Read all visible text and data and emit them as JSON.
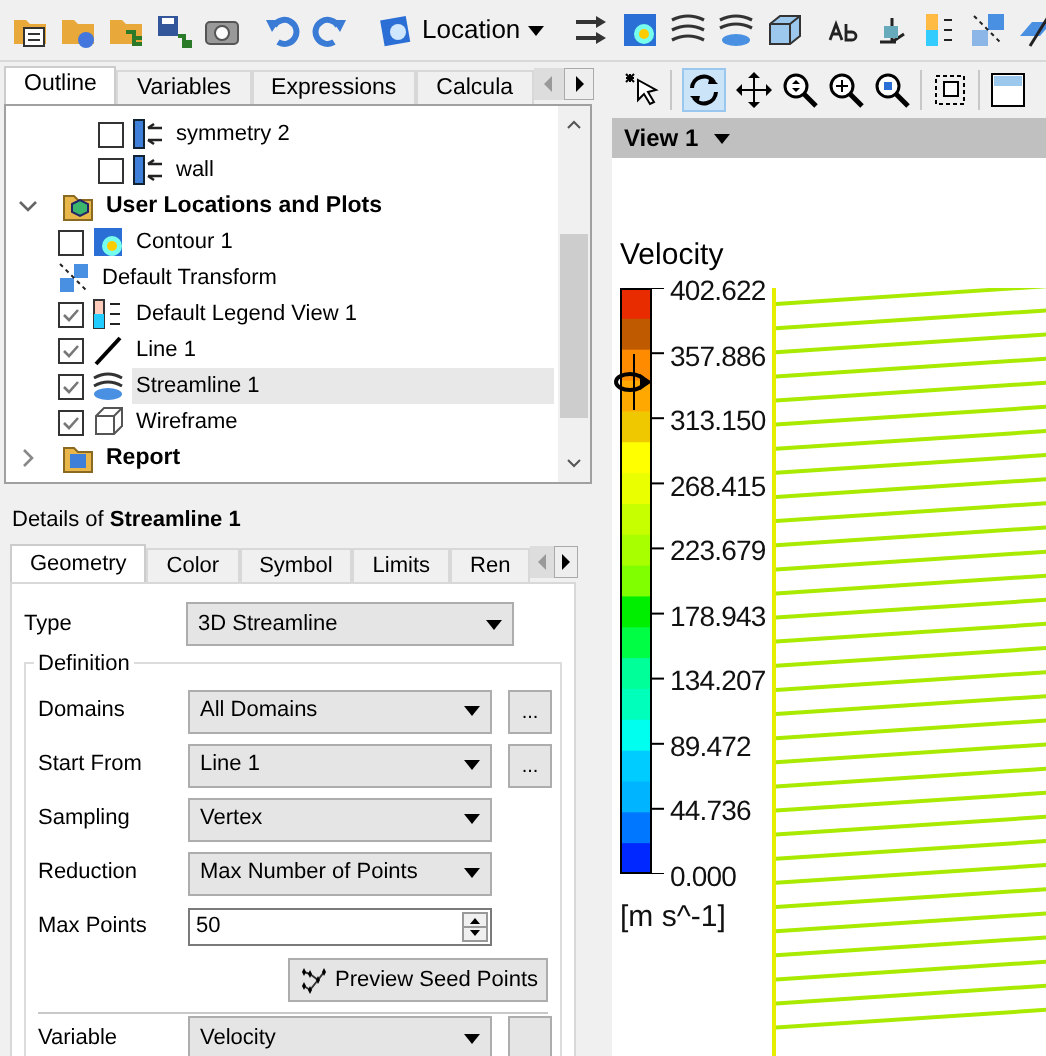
{
  "toolbar": {
    "location_button": "Location"
  },
  "panel_tabs": [
    {
      "label": "Outline",
      "selected": true
    },
    {
      "label": "Variables",
      "selected": false
    },
    {
      "label": "Expressions",
      "selected": false
    },
    {
      "label": "Calcula",
      "selected": false
    }
  ],
  "tree": [
    {
      "children": [
        {
          "children": [
            {
              "label": "symmetry 2",
              "kind": "boundary",
              "checked": false,
              "selected": false
            },
            {
              "label": "wall",
              "kind": "boundary",
              "checked": false,
              "selected": false
            }
          ]
        }
      ]
    },
    {
      "label": "User Locations and Plots",
      "kind": "folder",
      "expanded": true,
      "selected": false,
      "children": [
        {
          "label": "Contour 1",
          "kind": "contour",
          "checked": false,
          "selected": false
        },
        {
          "label": "Default Transform",
          "kind": "transform",
          "selected": false
        },
        {
          "label": "Default Legend View 1",
          "kind": "legend",
          "checked": true,
          "selected": false
        },
        {
          "label": "Line 1",
          "kind": "line",
          "checked": true,
          "selected": false
        },
        {
          "label": "Streamline 1",
          "kind": "streamline",
          "checked": true,
          "selected": true
        },
        {
          "label": "Wireframe",
          "kind": "wireframe",
          "checked": true,
          "selected": false
        }
      ]
    },
    {
      "label": "Report",
      "kind": "report",
      "expanded": false,
      "selected": false
    }
  ],
  "details": {
    "prefix": "Details of ",
    "object": "Streamline 1",
    "tabs": [
      {
        "label": "Geometry",
        "selected": true
      },
      {
        "label": "Color",
        "selected": false
      },
      {
        "label": "Symbol",
        "selected": false
      },
      {
        "label": "Limits",
        "selected": false
      },
      {
        "label": "Ren",
        "selected": false
      }
    ],
    "type": {
      "label": "Type",
      "value": "3D Streamline"
    },
    "definition": {
      "title": "Definition",
      "rows": [
        {
          "label": "Domains",
          "kind": "dropdown",
          "value": "All Domains",
          "more_button": "..."
        },
        {
          "label": "Start From",
          "kind": "dropdown",
          "value": "Line 1",
          "more_button": "..."
        },
        {
          "label": "Sampling",
          "kind": "dropdown",
          "value": "Vertex"
        },
        {
          "label": "Reduction",
          "kind": "dropdown",
          "value": "Max Number of Points"
        },
        {
          "label": "Max Points",
          "kind": "spinner",
          "value": "50"
        }
      ],
      "preview_button": "Preview Seed Points"
    },
    "variable": {
      "label": "Variable",
      "value": "Velocity"
    }
  },
  "view": {
    "title": "View 1",
    "legend": {
      "title": "Velocity",
      "ticks": [
        "402.622",
        "357.886",
        "313.150",
        "268.415",
        "223.679",
        "178.943",
        "134.207",
        "89.472",
        "44.736",
        "0.000"
      ],
      "units": "[m s^-1]"
    }
  }
}
